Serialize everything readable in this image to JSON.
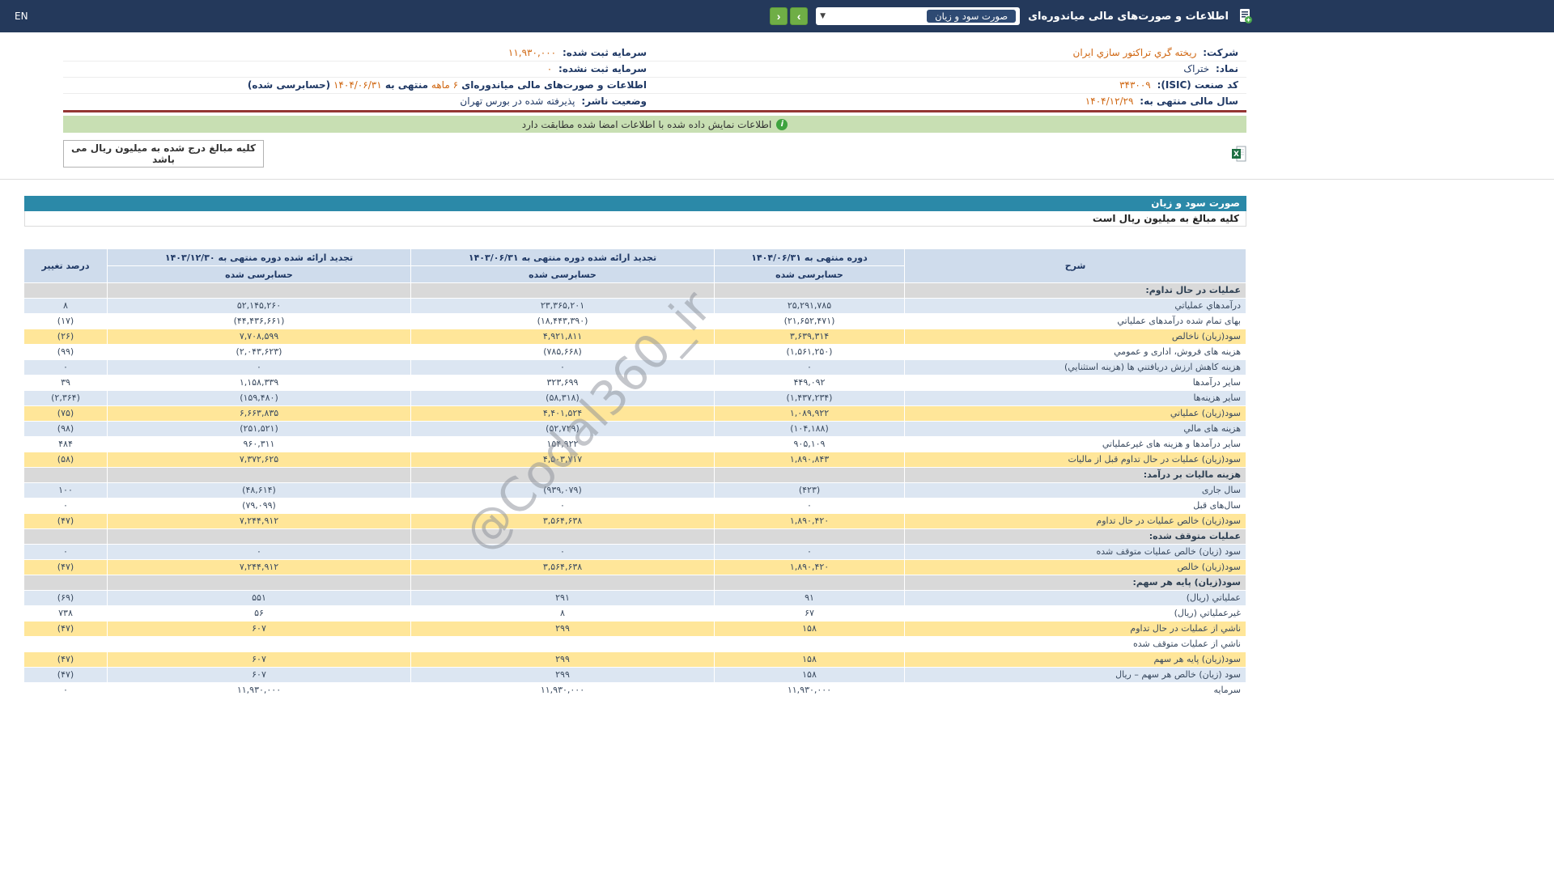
{
  "topbar": {
    "title": "اطلاعات و صورت‌های مالی میاندوره‌ای",
    "select_value": "صورت سود و زیان",
    "nav_next_icon": "›",
    "nav_prev_icon": "‹",
    "en_label": "EN"
  },
  "company": {
    "col_right": [
      {
        "label": "شرکت:",
        "value": "ریخته گري تراکتور سازي ایران"
      },
      {
        "label": "نماد:",
        "value": "ختراک"
      },
      {
        "label": "کد صنعت (ISIC):",
        "value": "۳۴۳۰۰۹"
      },
      {
        "label": "سال مالی منتهی به:",
        "value": "۱۴۰۴/۱۲/۲۹"
      }
    ],
    "col_left": [
      {
        "label": "سرمایه ثبت شده:",
        "value": "۱۱,۹۳۰,۰۰۰"
      },
      {
        "label": "سرمایه ثبت نشده:",
        "value": "۰"
      },
      {
        "p1": "اطلاعات و صورت‌های مالی میاندوره‌ای ",
        "p2": "۶ ماهه",
        "p3": " منتهی به ",
        "p4": "۱۴۰۴/۰۶/۳۱",
        "p5": "(حسابرسی شده)"
      },
      {
        "label": "وضعیت ناشر:",
        "value": "پذیرفته شده در بورس تهران"
      }
    ]
  },
  "notice": {
    "text": "اطلاعات نمایش داده شده با اطلاعات امضا شده مطابقت دارد"
  },
  "units": {
    "top_note": "کلیه مبالغ درج شده به میلیون ریال می باشد"
  },
  "watermark": {
    "text": "@Codal360_ir"
  },
  "statement": {
    "title": "صورت سود و زیان",
    "units_note": "کلیه مبالغ به میلیون ریال است",
    "col_headers": {
      "desc": "شرح",
      "periods": [
        {
          "title": "دوره منتهی به ۱۴۰۴/۰۶/۳۱",
          "sub": "حسابرسی شده"
        },
        {
          "title": "تجدید ارائه شده دوره منتهی به ۱۴۰۳/۰۶/۳۱",
          "sub": "حسابرسی شده"
        },
        {
          "title": "تجدید ارائه شده دوره منتهی به ۱۴۰۳/۱۲/۳۰",
          "sub": "حسابرسی شده"
        }
      ],
      "change": "درصد تغییر"
    },
    "rows": [
      {
        "type": "section",
        "desc": "عملیات در حال تداوم:"
      },
      {
        "type": "data",
        "bg": "blue",
        "desc": "درآمدهاي عملیاتي",
        "v": [
          "۲۵,۲۹۱,۷۸۵",
          "۲۳,۳۶۵,۲۰۱",
          "۵۲,۱۴۵,۲۶۰"
        ],
        "chg": "۸"
      },
      {
        "type": "data",
        "bg": "white",
        "desc": "بهاى تمام شده درآمدهاى عملیاتي",
        "v": [
          "(۲۱,۶۵۲,۴۷۱)",
          "(۱۸,۴۴۳,۳۹۰)",
          "(۴۴,۴۳۶,۶۶۱)"
        ],
        "chg": "(۱۷)"
      },
      {
        "type": "data",
        "bg": "yellow",
        "desc": "سود(زیان) ناخالص",
        "v": [
          "۳,۶۳۹,۳۱۴",
          "۴,۹۲۱,۸۱۱",
          "۷,۷۰۸,۵۹۹"
        ],
        "chg": "(۲۶)"
      },
      {
        "type": "data",
        "bg": "white",
        "desc": "هزینه هاى فروش، ادارى و عمومي",
        "v": [
          "(۱,۵۶۱,۲۵۰)",
          "(۷۸۵,۶۶۸)",
          "(۲,۰۴۳,۶۲۳)"
        ],
        "chg": "(۹۹)"
      },
      {
        "type": "data",
        "bg": "blue",
        "desc": "هزینه کاهش ارزش دریافتني ها (هزینه استثنایي)",
        "v": [
          "۰",
          "۰",
          "۰"
        ],
        "chg": "۰"
      },
      {
        "type": "data",
        "bg": "white",
        "desc": "سایر درآمدها",
        "v": [
          "۴۴۹,۰۹۲",
          "۳۲۳,۶۹۹",
          "۱,۱۵۸,۳۳۹"
        ],
        "chg": "۳۹"
      },
      {
        "type": "data",
        "bg": "blue",
        "desc": "سایر هزینه‌ها",
        "v": [
          "(۱,۴۳۷,۲۳۴)",
          "(۵۸,۳۱۸)",
          "(۱۵۹,۴۸۰)"
        ],
        "chg": "(۲,۳۶۴)"
      },
      {
        "type": "data",
        "bg": "yellow",
        "desc": "سود(زیان) عملیاتي",
        "v": [
          "۱,۰۸۹,۹۲۲",
          "۴,۴۰۱,۵۲۴",
          "۶,۶۶۳,۸۳۵"
        ],
        "chg": "(۷۵)"
      },
      {
        "type": "data",
        "bg": "blue",
        "desc": "هزینه هاى مالي",
        "v": [
          "(۱۰۴,۱۸۸)",
          "(۵۲,۷۲۹)",
          "(۲۵۱,۵۲۱)"
        ],
        "chg": "(۹۸)"
      },
      {
        "type": "data",
        "bg": "white",
        "desc": "سایر درآمدها و هزینه هاى غیرعملیاتي",
        "v": [
          "۹۰۵,۱۰۹",
          "۱۵۴,۹۲۲",
          "۹۶۰,۳۱۱"
        ],
        "chg": "۴۸۴"
      },
      {
        "type": "data",
        "bg": "yellow",
        "desc": "سود(زیان) عملیات در حال تداوم قبل از مالیات",
        "v": [
          "۱,۸۹۰,۸۴۳",
          "۴,۵۰۳,۷۱۷",
          "۷,۳۷۲,۶۲۵"
        ],
        "chg": "(۵۸)"
      },
      {
        "type": "section",
        "desc": "هزینه مالیات بر درآمد:"
      },
      {
        "type": "data",
        "bg": "blue",
        "desc": "سال جاری",
        "v": [
          "(۴۲۳)",
          "(۹۳۹,۰۷۹)",
          "(۴۸,۶۱۴)"
        ],
        "chg": "۱۰۰"
      },
      {
        "type": "data",
        "bg": "white",
        "desc": "سال‌های قبل",
        "v": [
          "۰",
          "۰",
          "(۷۹,۰۹۹)"
        ],
        "chg": "۰"
      },
      {
        "type": "data",
        "bg": "yellow",
        "desc": "سود(زیان) خالص عملیات در حال تداوم",
        "v": [
          "۱,۸۹۰,۴۲۰",
          "۳,۵۶۴,۶۳۸",
          "۷,۲۴۴,۹۱۲"
        ],
        "chg": "(۴۷)"
      },
      {
        "type": "section",
        "desc": "عملیات متوقف شده:"
      },
      {
        "type": "data",
        "bg": "blue",
        "desc": "سود (زیان) خالص عملیات متوقف شده",
        "v": [
          "۰",
          "۰",
          "۰"
        ],
        "chg": "۰"
      },
      {
        "type": "data",
        "bg": "yellow",
        "desc": "سود(زیان) خالص",
        "v": [
          "۱,۸۹۰,۴۲۰",
          "۳,۵۶۴,۶۳۸",
          "۷,۲۴۴,۹۱۲"
        ],
        "chg": "(۴۷)"
      },
      {
        "type": "section",
        "desc": "سود(زیان) پایه هر سهم:"
      },
      {
        "type": "data",
        "bg": "blue",
        "desc": "عملیاتي (ریال)",
        "v": [
          "۹۱",
          "۲۹۱",
          "۵۵۱"
        ],
        "chg": "(۶۹)"
      },
      {
        "type": "data",
        "bg": "white",
        "desc": "غیرعملیاتي (ریال)",
        "v": [
          "۶۷",
          "۸",
          "۵۶"
        ],
        "chg": "۷۳۸"
      },
      {
        "type": "data",
        "bg": "yellow",
        "desc": "ناشي از عملیات در حال تداوم",
        "v": [
          "۱۵۸",
          "۲۹۹",
          "۶۰۷"
        ],
        "chg": "(۴۷)"
      },
      {
        "type": "data",
        "bg": "white",
        "desc": "ناشي از عملیات متوقف شده",
        "v": [
          "",
          "",
          ""
        ],
        "chg": ""
      },
      {
        "type": "data",
        "bg": "yellow",
        "desc": "سود(زیان) پایه هر سهم",
        "v": [
          "۱۵۸",
          "۲۹۹",
          "۶۰۷"
        ],
        "chg": "(۴۷)"
      },
      {
        "type": "data",
        "bg": "blue",
        "desc": "سود (زیان) خالص هر سهم – ریال",
        "v": [
          "۱۵۸",
          "۲۹۹",
          "۶۰۷"
        ],
        "chg": "(۴۷)"
      },
      {
        "type": "data",
        "bg": "white",
        "desc": "سرمایه",
        "v": [
          "۱۱,۹۳۰,۰۰۰",
          "۱۱,۹۳۰,۰۰۰",
          "۱۱,۹۳۰,۰۰۰"
        ],
        "chg": "۰"
      }
    ]
  },
  "colors": {
    "topbar_bg": "#24395b",
    "accent_green": "#6fae46",
    "accent_orange": "#d06712",
    "negative_red": "#e80000",
    "section_gray": "#d9d9d9",
    "row_blue": "#dce6f2",
    "row_yellow": "#ffe699",
    "titlebar_teal": "#2b89a8",
    "notice_green": "#c8dfb3",
    "divider_red": "#943634"
  }
}
